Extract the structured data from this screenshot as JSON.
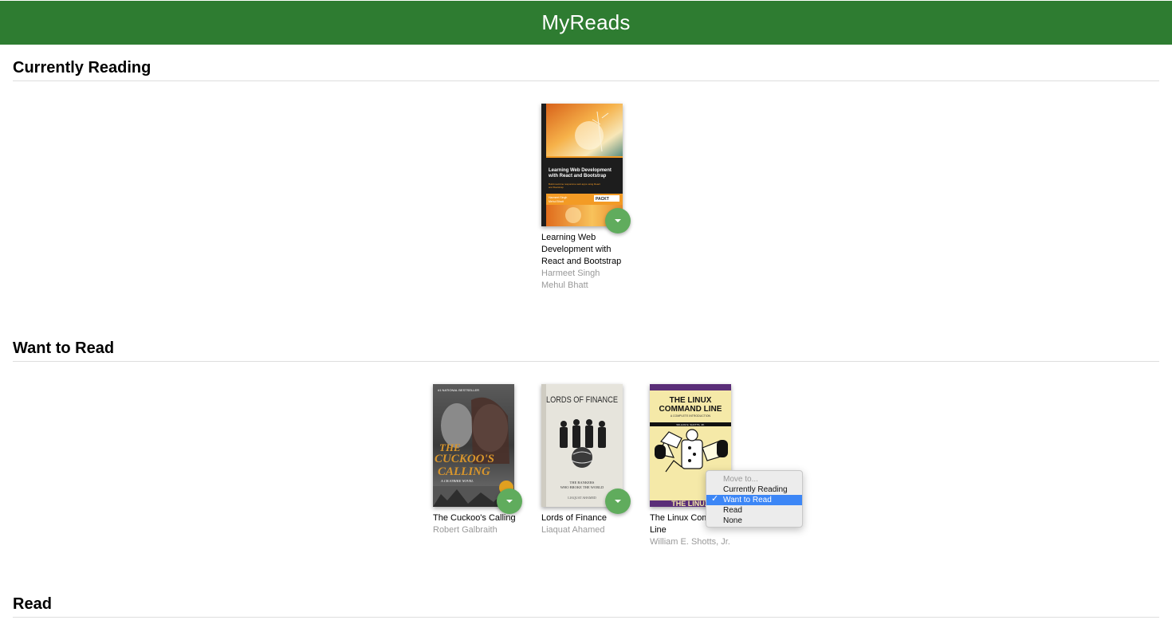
{
  "app": {
    "title": "MyReads"
  },
  "shelves": [
    {
      "title": "Currently Reading"
    },
    {
      "title": "Want to Read"
    },
    {
      "title": "Read"
    }
  ],
  "books": {
    "react_bootstrap": {
      "title": "Learning Web Development with React and Bootstrap",
      "authors": [
        "Harmeet Singh",
        "Mehul Bhatt"
      ],
      "cover_title": "Learning Web Development with React and Bootstrap",
      "cover_subtitle": "Build real-time responsive web apps using React and Bootstrap",
      "cover_authors": "Harmeet Singh\nMehul Bhatt",
      "cover_publisher": "PACKT"
    },
    "cuckoos_calling": {
      "title": "The Cuckoo's Calling",
      "authors": [
        "Robert Galbraith"
      ],
      "cover_top": "#1 NATIONAL BESTSELLER",
      "cover_line1": "THE",
      "cover_line2": "CUCKOO'S",
      "cover_line3": "CALLING",
      "cover_series": "A CB STRIKE NOVEL"
    },
    "lords_of_finance": {
      "title": "Lords of Finance",
      "authors": [
        "Liaquat Ahamed"
      ],
      "cover_title": "LORDS OF FINANCE",
      "cover_sub1": "THE BANKERS",
      "cover_sub2": "WHO BROKE THE WORLD",
      "cover_author": "LIAQUAT AHAMED"
    },
    "linux_command_line": {
      "title": "The Linux Command Line",
      "authors": [
        "William E. Shotts, Jr."
      ],
      "cover_title1": "THE LINUX",
      "cover_title2": "COMMAND LINE",
      "cover_sub": "A COMPLETE INTRODUCTION",
      "cover_author": "WILLIAM E. SHOTTS, JR.",
      "cover_bottom": "THE LINUX"
    }
  },
  "move_menu": {
    "header": "Move to...",
    "options": [
      "Currently Reading",
      "Want to Read",
      "Read",
      "None"
    ],
    "selected": "Want to Read",
    "check": "✓"
  },
  "colors": {
    "header_bg": "#2e7c31",
    "shelf_changer": "#60ac5d",
    "menu_highlight": "#3c86f6"
  }
}
